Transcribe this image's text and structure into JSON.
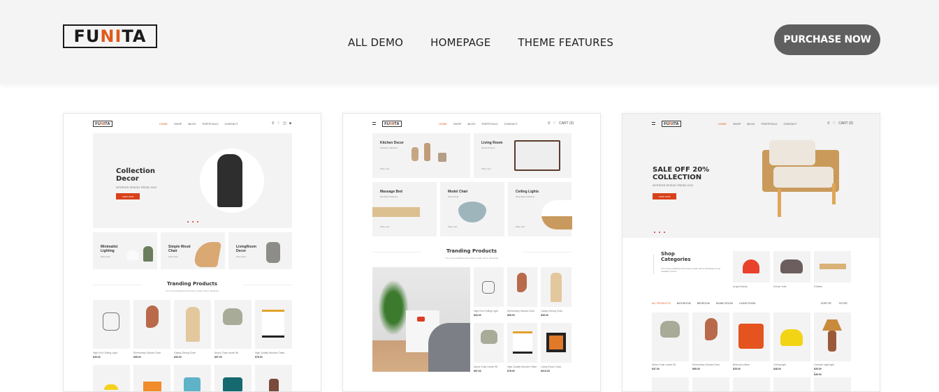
{
  "header": {
    "logo": {
      "pre": "FU",
      "accent": "N",
      "mid": "I",
      "post": "TA"
    },
    "nav": [
      "ALL DEMO",
      "HOMEPAGE",
      "THEME FEATURES"
    ],
    "purchase_label": "PURCHASE NOW"
  },
  "colors": {
    "accent": "#e05a1c",
    "button": "#5f5f5f",
    "header_bg": "#f4f4f4"
  },
  "mini_nav": [
    "HOME",
    "SHOP",
    "BLOG",
    "PORTFOLIO",
    "CONTACT"
  ],
  "mini_logo": "FUNITA",
  "demos": [
    {
      "hero": {
        "title_line1": "Collection",
        "title_line2": "Decor",
        "subtitle": "INTERIOR DESIGN TREND 2019",
        "button": "SHOP NOW"
      },
      "banners": [
        {
          "title_line1": "Minimalist",
          "title_line2": "Lighting",
          "link": "Shop Now"
        },
        {
          "title_line1": "Simple Wood",
          "title_line2": "Chair",
          "link": "Shop Now"
        },
        {
          "title_line1": "LivingRoom",
          "title_line2": "Decor",
          "link": "Shop Now"
        }
      ],
      "section_title": "Tranding Products",
      "section_sub": "It is a long established fact that a reader will be distracted",
      "products": [
        {
          "name": "High End Ceiling Light",
          "price": "$30.00"
        },
        {
          "name": "Elementary Saluda Chair",
          "price": "$95.00"
        },
        {
          "name": "Galaxy Dining Chair",
          "price": "$30.00"
        },
        {
          "name": "About Chair model 98",
          "price": "$97.00"
        },
        {
          "name": "High Quality Wooden Table",
          "price": "$78.00"
        }
      ],
      "cart_count": "0"
    },
    {
      "tiles": [
        {
          "title": "Kitchen Decor",
          "sub": "Wooden Collection",
          "link": "Shop now"
        },
        {
          "title": "Living Room",
          "sub": "Wood furniture",
          "link": "Shop now"
        },
        {
          "title": "Massage Bed",
          "sub": "Mini Bed Collection",
          "link": "Shop now"
        },
        {
          "title": "Model Chair",
          "sub": "New Arrival",
          "link": "Shop now"
        },
        {
          "title": "Ceiling Lights",
          "sub": "Minimalist Collection",
          "link": "Shop now"
        }
      ],
      "section_title": "Tranding Products",
      "section_sub": "It is a long established fact that a reader will be distracted",
      "products": [
        {
          "name": "High End Ceiling Light",
          "price": "$30.00"
        },
        {
          "name": "Elementary Saluda Chair",
          "price": "$95.00"
        },
        {
          "name": "Galaxy Dining Chair",
          "price": "$35.00"
        },
        {
          "name": "About Chair model 98",
          "price": "$97.00"
        },
        {
          "name": "High Quality Wooden Table",
          "price": "$78.00"
        },
        {
          "name": "Living Room Clock",
          "price": "$210.00"
        }
      ],
      "cart_label": "CART (0)"
    },
    {
      "hero": {
        "title_line1": "SALE OFF 20%",
        "title_line2": "COLLECTION",
        "subtitle": "INTERIOR DESIGN TREND 2020",
        "button": "SHOP NOW"
      },
      "categories_title_line1": "Shop",
      "categories_title_line2": "Categories",
      "categories_desc": "It is a long established fact that a reader will be distracted by the readable content",
      "categories": [
        "#Light Infinity",
        "#Chair Sofa",
        "#Tables"
      ],
      "filter_tabs": [
        "ALL PRODUCTS",
        "BATHROOM",
        "BEDROOM",
        "DINING ROOM",
        "LIVING ROOM"
      ],
      "sort_label": "SORT BY",
      "filter_label": "FILTER",
      "products": [
        {
          "name": "About Chair model 98",
          "price": "$47.00"
        },
        {
          "name": "Elementary Saluda Chair",
          "price": "$95.00"
        },
        {
          "name": "Bedroom pillow",
          "price": "$25.00"
        },
        {
          "name": "Ceiling light",
          "price": "$48.00"
        },
        {
          "name": "Ceramic night light",
          "price": "$30.00 – $40.00"
        }
      ],
      "cart_label": "CART (0)"
    }
  ]
}
